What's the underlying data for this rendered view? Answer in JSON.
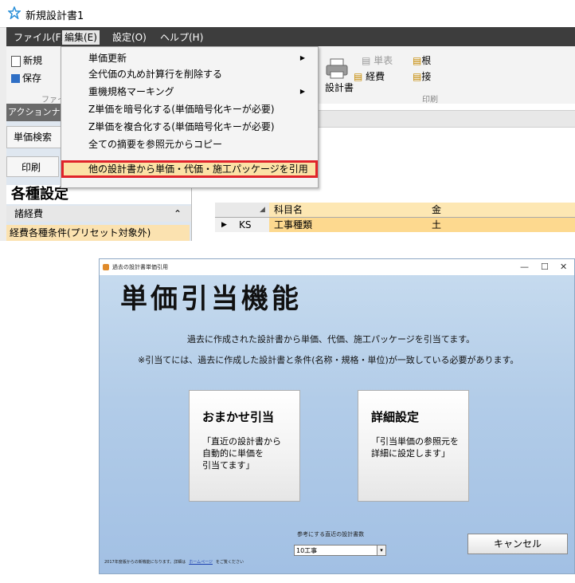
{
  "top_window": {
    "title": "新規設計書1",
    "menu": [
      "ファイル(F)",
      "編集(E)",
      "設定(O)",
      "ヘルプ(H)"
    ],
    "menu_active_index": 1,
    "ribbon": {
      "new_label": "新規",
      "save_label": "保存",
      "file_group_label": "ファイ",
      "design_doc_label": "設計書",
      "unit_table_label": "単表",
      "expense_label": "経費",
      "root_label": "根",
      "ext_label": "接",
      "print_group_label": "印刷"
    },
    "left_panel": {
      "action_nav": "アクションナビ",
      "unit_search": "単価検索",
      "print": "印刷",
      "settings_heading": "各種設定",
      "misc_expenses": "諸経費",
      "expense_conditions": "経費各種条件(プリセット対象外)"
    },
    "grid": {
      "col_subject": "科目名",
      "col_partial": "金",
      "row_code": "KS",
      "row_name": "工事種類",
      "row_partial": "土"
    },
    "edit_menu": {
      "items": [
        {
          "label": "単価更新",
          "submenu": true
        },
        {
          "label": "全代価の丸め計算行を削除する",
          "submenu": false
        },
        {
          "label": "重機規格マーキング",
          "submenu": true
        },
        {
          "label": "Z単価を暗号化する(単価暗号化キーが必要)",
          "submenu": false
        },
        {
          "label": "Z単価を複合化する(単価暗号化キーが必要)",
          "submenu": false
        },
        {
          "label": "全ての摘要を参照元からコピー",
          "submenu": false
        },
        {
          "label": "他の設計書から単価・代価・施工パッケージを引用",
          "submenu": false
        }
      ],
      "selected_index": 6
    }
  },
  "dialog": {
    "title": "過去の設計書単価引用",
    "heading": "単価引当機能",
    "subtitle1": "過去に作成された設計書から単価、代価、施工パッケージを引当てます。",
    "subtitle2": "※引当てには、過去に作成した設計書と条件(名称・規格・単位)が一致している必要があります。",
    "auto_button": {
      "title": "おまかせ引当",
      "desc": "「直近の設計書から\n自動的に単価を\n引当てます」"
    },
    "detail_button": {
      "title": "詳細設定",
      "desc": "「引当単価の参照元を\n詳細に設定します」"
    },
    "reference_label": "参考にする直近の設計書数",
    "reference_value": "10工事",
    "footer_prefix": "2017年度版からの新機能になります。詳細は",
    "footer_link": "ホームページ",
    "footer_suffix": "をご覧ください",
    "cancel_label": "キャンセル",
    "window_controls": [
      "—",
      "☐",
      "✕"
    ]
  },
  "colors": {
    "menubar": "#3d3d3d",
    "selected_item_bg": "#fbe2a6",
    "selected_item_border": "#e0242a",
    "dialog_bg": "#b2cce8"
  }
}
